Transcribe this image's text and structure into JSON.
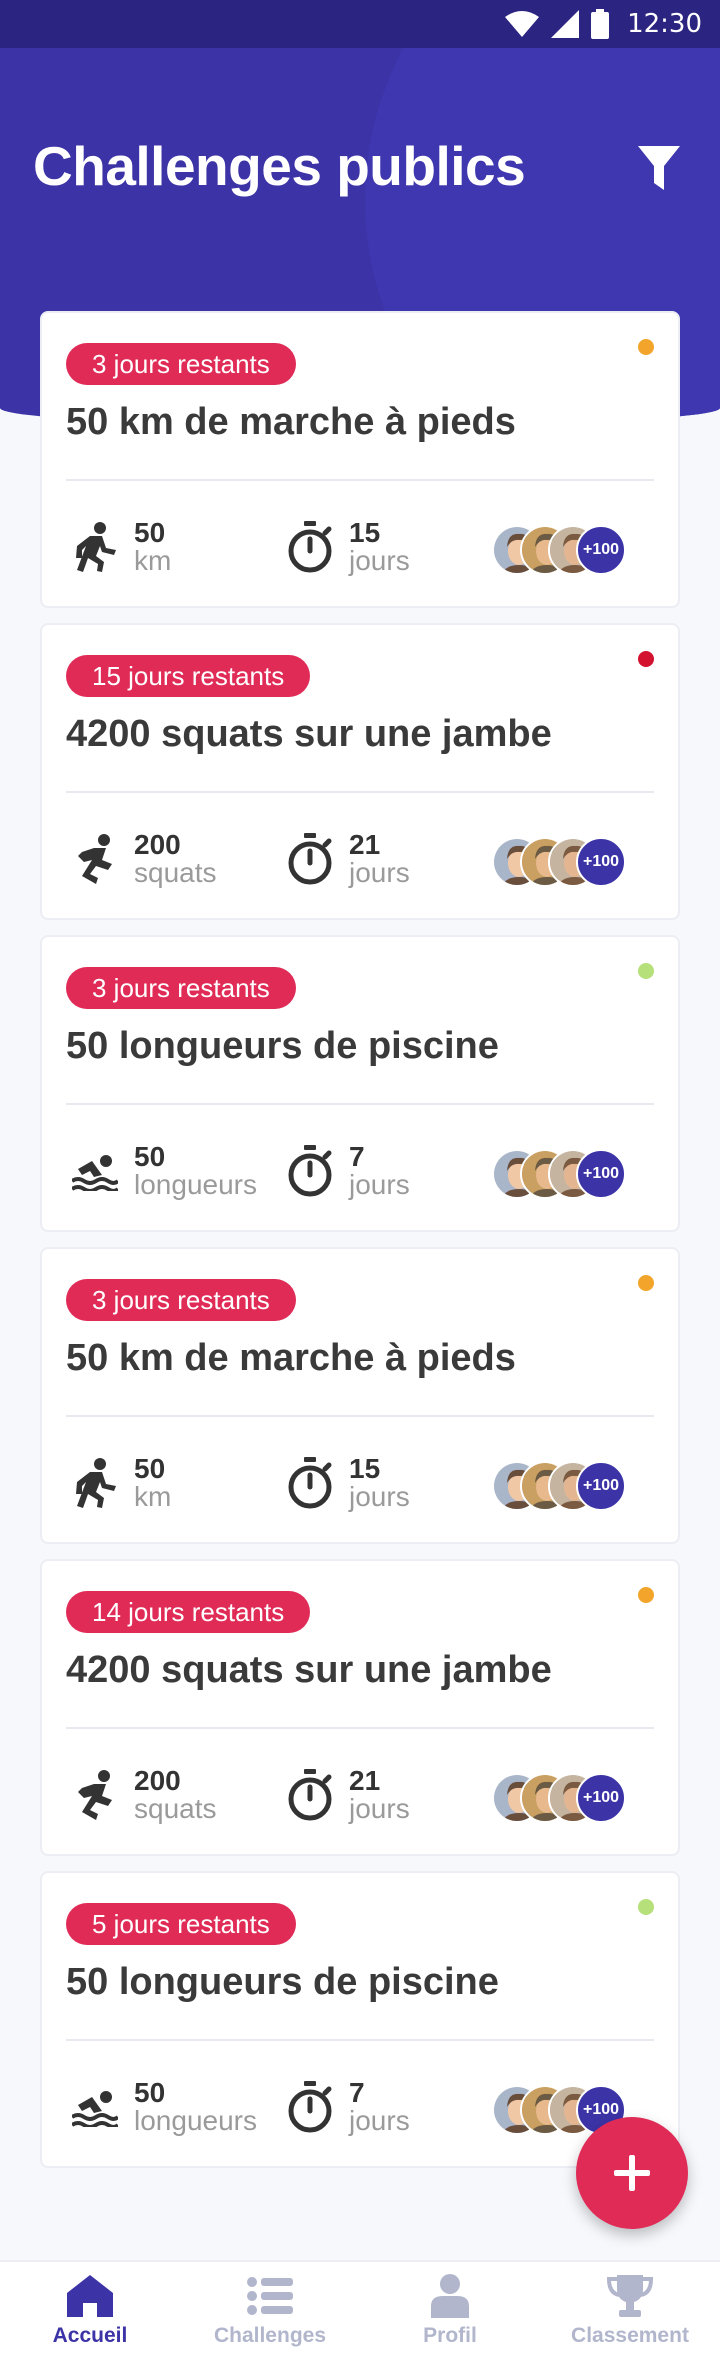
{
  "status_bar": {
    "time": "12:30"
  },
  "header": {
    "title": "Challenges publics",
    "filter_icon": "filter-icon"
  },
  "colors": {
    "primary": "#3c33a6",
    "accent": "#e02b57",
    "dot_orange": "#f2a52a",
    "dot_red": "#d3122f",
    "dot_green": "#b6e07a"
  },
  "cards": [
    {
      "badge": "3 jours restants",
      "dot": "orange",
      "title": "50 km de marche à pieds",
      "activity_icon": "walking-icon",
      "value": "50",
      "unit": "km",
      "duration": "15",
      "duration_unit": "jours",
      "participants_more": "+100"
    },
    {
      "badge": "15 jours restants",
      "dot": "red",
      "title": "4200 squats sur une jambe",
      "activity_icon": "squat-icon",
      "value": "200",
      "unit": "squats",
      "duration": "21",
      "duration_unit": "jours",
      "participants_more": "+100"
    },
    {
      "badge": "3 jours restants",
      "dot": "green",
      "title": "50 longueurs de piscine",
      "activity_icon": "swimming-icon",
      "value": "50",
      "unit": "longueurs",
      "duration": "7",
      "duration_unit": "jours",
      "participants_more": "+100"
    },
    {
      "badge": "3 jours restants",
      "dot": "orange",
      "title": "50 km de marche à pieds",
      "activity_icon": "walking-icon",
      "value": "50",
      "unit": "km",
      "duration": "15",
      "duration_unit": "jours",
      "participants_more": "+100"
    },
    {
      "badge": "14 jours restants",
      "dot": "orange",
      "title": "4200 squats sur une jambe",
      "activity_icon": "squat-icon",
      "value": "200",
      "unit": "squats",
      "duration": "21",
      "duration_unit": "jours",
      "participants_more": "+100"
    },
    {
      "badge": "5 jours restants",
      "dot": "green",
      "title": "50 longueurs de piscine",
      "activity_icon": "swimming-icon",
      "value": "50",
      "unit": "longueurs",
      "duration": "7",
      "duration_unit": "jours",
      "participants_more": "+100"
    }
  ],
  "fab": {
    "icon": "plus-icon"
  },
  "bottom_nav": [
    {
      "label": "Accueil",
      "icon": "home-icon",
      "active": true
    },
    {
      "label": "Challenges",
      "icon": "list-icon",
      "active": false
    },
    {
      "label": "Profil",
      "icon": "person-icon",
      "active": false
    },
    {
      "label": "Classement",
      "icon": "trophy-icon",
      "active": false
    }
  ]
}
